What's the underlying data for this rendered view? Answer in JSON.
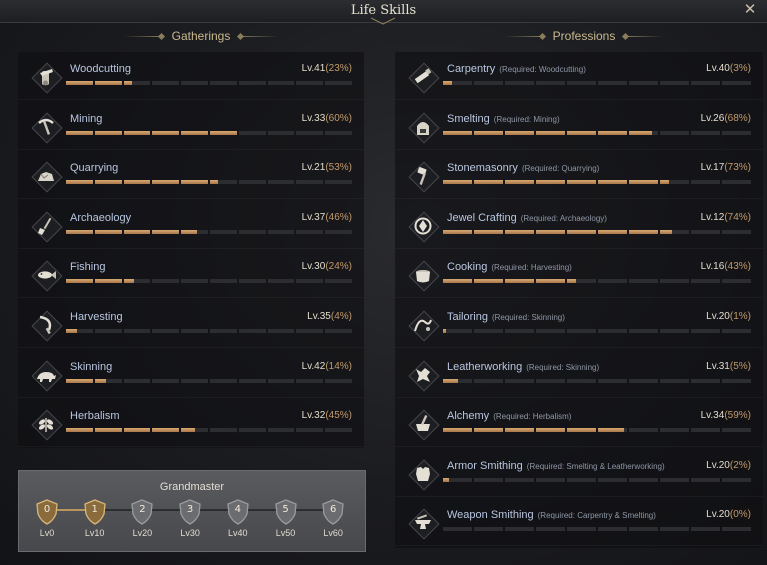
{
  "window": {
    "title": "Life Skills"
  },
  "gatherings_heading": "Gatherings",
  "professions_heading": "Professions",
  "gatherings": [
    {
      "name": "Woodcutting",
      "level": "Lv.41",
      "percent": "(23%)",
      "fill": 0.23,
      "icon": "wood-icon"
    },
    {
      "name": "Mining",
      "level": "Lv.33",
      "percent": "(60%)",
      "fill": 0.6,
      "icon": "pickaxe-icon"
    },
    {
      "name": "Quarrying",
      "level": "Lv.21",
      "percent": "(53%)",
      "fill": 0.53,
      "icon": "stone-icon"
    },
    {
      "name": "Archaeology",
      "level": "Lv.37",
      "percent": "(46%)",
      "fill": 0.46,
      "icon": "shovel-icon"
    },
    {
      "name": "Fishing",
      "level": "Lv.30",
      "percent": "(24%)",
      "fill": 0.24,
      "icon": "fish-icon"
    },
    {
      "name": "Harvesting",
      "level": "Lv.35",
      "percent": "(4%)",
      "fill": 0.04,
      "icon": "sickle-icon"
    },
    {
      "name": "Skinning",
      "level": "Lv.42",
      "percent": "(14%)",
      "fill": 0.14,
      "icon": "beast-icon"
    },
    {
      "name": "Herbalism",
      "level": "Lv.32",
      "percent": "(45%)",
      "fill": 0.45,
      "icon": "herb-icon"
    }
  ],
  "professions": [
    {
      "name": "Carpentry",
      "req": "(Required: Woodcutting)",
      "level": "Lv.40",
      "percent": "(3%)",
      "fill": 0.03,
      "icon": "saw-icon"
    },
    {
      "name": "Smelting",
      "req": "(Required: Mining)",
      "level": "Lv.26",
      "percent": "(68%)",
      "fill": 0.68,
      "icon": "furnace-icon"
    },
    {
      "name": "Stonemasonry",
      "req": "(Required: Quarrying)",
      "level": "Lv.17",
      "percent": "(73%)",
      "fill": 0.73,
      "icon": "chisel-icon"
    },
    {
      "name": "Jewel Crafting",
      "req": "(Required: Archaeology)",
      "level": "Lv.12",
      "percent": "(74%)",
      "fill": 0.74,
      "icon": "gem-icon"
    },
    {
      "name": "Cooking",
      "req": "(Required: Harvesting)",
      "level": "Lv.16",
      "percent": "(43%)",
      "fill": 0.43,
      "icon": "pot-icon"
    },
    {
      "name": "Tailoring",
      "req": "(Required: Skinning)",
      "level": "Lv.20",
      "percent": "(1%)",
      "fill": 0.01,
      "icon": "thread-icon"
    },
    {
      "name": "Leatherworking",
      "req": "(Required: Skinning)",
      "level": "Lv.31",
      "percent": "(5%)",
      "fill": 0.05,
      "icon": "leather-icon"
    },
    {
      "name": "Alchemy",
      "req": "(Required: Herbalism)",
      "level": "Lv.34",
      "percent": "(59%)",
      "fill": 0.59,
      "icon": "mortar-icon"
    },
    {
      "name": "Armor Smithing",
      "req": "(Required: Smelting & Leatherworking)",
      "level": "Lv.20",
      "percent": "(2%)",
      "fill": 0.02,
      "icon": "armor-icon"
    },
    {
      "name": "Weapon Smithing",
      "req": "(Required: Carpentry & Smelting)",
      "level": "Lv.20",
      "percent": "(0%)",
      "fill": 0.0,
      "icon": "anvil-icon"
    }
  ],
  "grandmaster": {
    "title": "Grandmaster",
    "tiers": [
      {
        "num": "0",
        "label": "Lv0",
        "achieved": true
      },
      {
        "num": "1",
        "label": "Lv10",
        "achieved": true
      },
      {
        "num": "2",
        "label": "Lv20",
        "achieved": false
      },
      {
        "num": "3",
        "label": "Lv30",
        "achieved": false
      },
      {
        "num": "4",
        "label": "Lv40",
        "achieved": false
      },
      {
        "num": "5",
        "label": "Lv50",
        "achieved": false
      },
      {
        "num": "6",
        "label": "Lv60",
        "achieved": false
      }
    ]
  },
  "colors": {
    "accent": "#c9a26e",
    "label": "#b9c6e0",
    "percent": "#c29a6a"
  }
}
